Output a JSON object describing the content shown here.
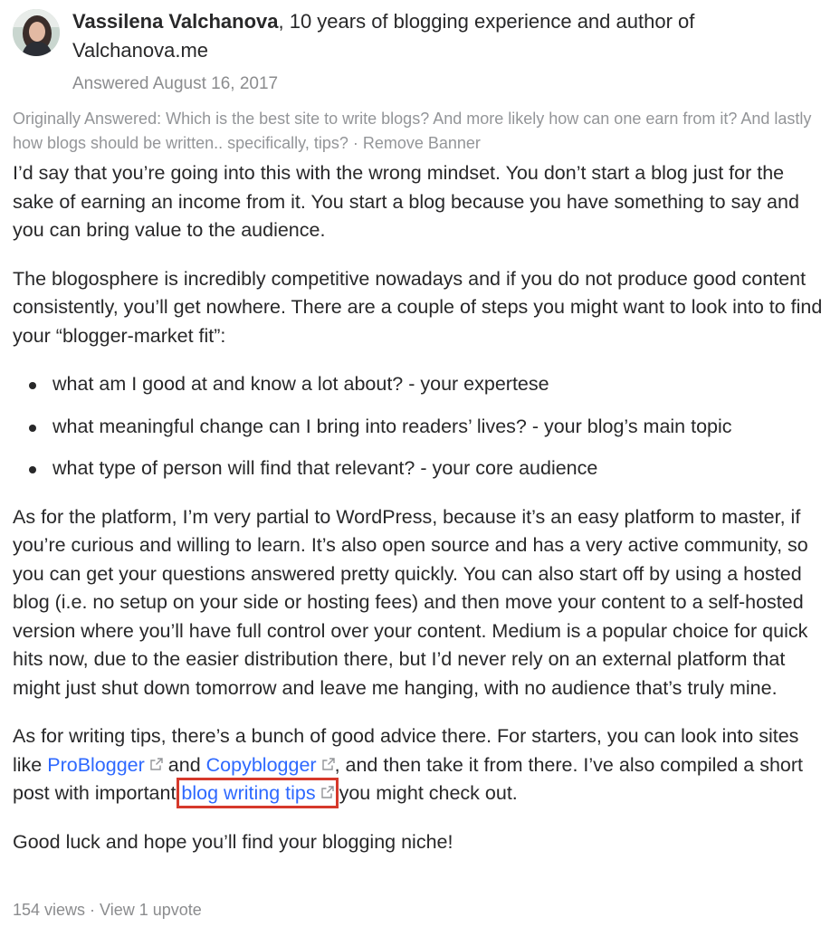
{
  "author": {
    "name": "Vassilena Valchanova",
    "credential": ", 10 years of blogging experience and author of Valchanova.me",
    "answered": "Answered August 16, 2017"
  },
  "original_question": {
    "text": "Originally Answered: Which is the best site to write blogs? And more likely how can one earn from it? And lastly how blogs should be written.. specifically, tips?",
    "separator": " · ",
    "remove_banner": "Remove Banner"
  },
  "answer": {
    "p1": "I’d say that you’re going into this with the wrong mindset. You don’t start a blog just for the sake of earning an income from it. You start a blog because you have something to say and you can bring value to the audience.",
    "p2": "The blogosphere is incredibly competitive nowadays and if you do not produce good content consistently, you’ll get nowhere. There are a couple of steps you might want to look into to find your “blogger-market fit”:",
    "bullets": [
      "what am I good at and know a lot about? - your expertese",
      "what meaningful change can I bring into readers’ lives? - your blog’s main topic",
      "what type of person will find that relevant? - your core audience"
    ],
    "p3": "As for the platform, I’m very partial to WordPress, because it’s an easy platform to master, if you’re curious and willing to learn. It’s also open source and has a very active community, so you can get your questions answered pretty quickly. You can also start off by using a hosted blog (i.e. no setup on your side or hosting fees) and then move your content to a self-hosted version where you’ll have full control over your content. Medium is a popular choice for quick hits now, due to the easier distribution there, but I’d never rely on an external platform that might just shut down tomorrow and leave me hanging, with no audience that’s truly mine.",
    "p4": {
      "part1": "As for writing tips, there’s a bunch of good advice there. For starters, you can look into sites like ",
      "link1": "ProBlogger",
      "part2": " and ",
      "link2": "Copyblogger",
      "part3": ", and then take it from there. I’ve also compiled a short post with important ",
      "link3": "blog writing tips",
      "part4": " you might check out."
    },
    "p5": "Good luck and hope you’ll find your blogging niche!"
  },
  "stats": {
    "views": "154 views",
    "separator": " · ",
    "upvotes": "View 1 upvote"
  },
  "colors": {
    "link": "#2e69ff",
    "highlight_box": "#d6392b",
    "muted_text": "#8b8c8e"
  },
  "icons": [
    "external-link-icon",
    "avatar"
  ]
}
